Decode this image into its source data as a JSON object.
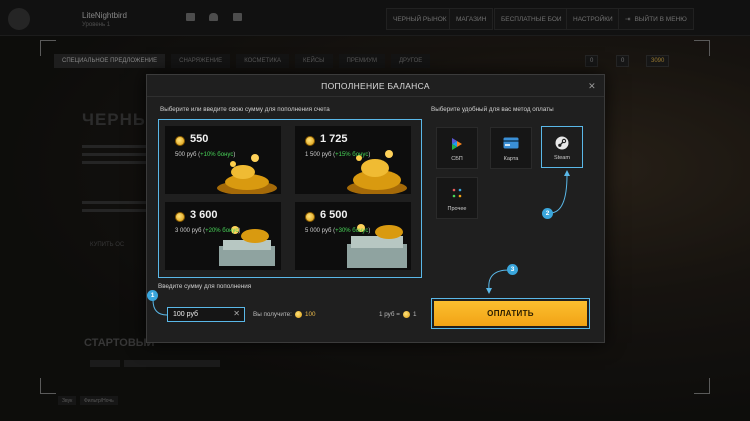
{
  "header": {
    "username": "LiteNightbird",
    "user_subtitle": "Уровень 1",
    "nav": [
      "ЧЕРНЫЙ РЫНОК",
      "МАГАЗИН",
      "БЕСПЛАТНЫЕ БОИ",
      "НАСТРОЙКИ",
      "ВЫЙТИ В МЕНЮ"
    ]
  },
  "tabs": [
    "СПЕЦИАЛЬНОЕ ПРЕДЛОЖЕНИЕ",
    "СНАРЯЖЕНИЕ",
    "КОСМЕТИКА",
    "КЕЙСЫ",
    "ПРЕМИУМ",
    "ДРУГОЕ"
  ],
  "stats": [
    "0",
    "0",
    "3090"
  ],
  "background": {
    "side_title": "ЧЕРНЫ",
    "buy_link": "КУПИТЬ ОС",
    "bottom_title": "СТАРТОВЫЙ",
    "bottom_chips": [
      "Звук",
      "Фильтр/Ночь"
    ]
  },
  "modal": {
    "title": "ПОПОЛНЕНИЕ БАЛАНСА",
    "packs_label": "Выберите или введите свою сумму для пополнения счета",
    "methods_label": "Выберите удобный для вас метод оплаты",
    "packs": [
      {
        "amount": "550",
        "price": "500 руб (",
        "bonus": "+10% бонус",
        "close": ")"
      },
      {
        "amount": "1 725",
        "price": "1 500 руб (",
        "bonus": "+15% бонус",
        "close": ")"
      },
      {
        "amount": "3 600",
        "price": "3 000 руб (",
        "bonus": "+20% бонус",
        "close": ")"
      },
      {
        "amount": "6 500",
        "price": "5 000 руб (",
        "bonus": "+30% бонус",
        "close": ")"
      }
    ],
    "amount_label": "Введите сумму для пополнения",
    "amount_value": "100 руб",
    "clear_symbol": "✕",
    "receive_label": "Вы получите:",
    "receive_value": "100",
    "rate_left": "1 руб =",
    "rate_right": "1",
    "methods": [
      {
        "label": "СБП",
        "icon": "sbp-icon",
        "selected": false
      },
      {
        "label": "Карта",
        "icon": "card-icon",
        "selected": false
      },
      {
        "label": "Steam",
        "icon": "steam-icon",
        "selected": true
      },
      {
        "label": "Прочее",
        "icon": "other-icon",
        "selected": false
      }
    ],
    "pay_label": "ОПЛАТИТЬ",
    "steps": [
      "1",
      "2",
      "3"
    ]
  },
  "colors": {
    "accent_blue": "#5ab8e8",
    "pay_button": "#f7b121",
    "bonus_green": "#48d458"
  }
}
